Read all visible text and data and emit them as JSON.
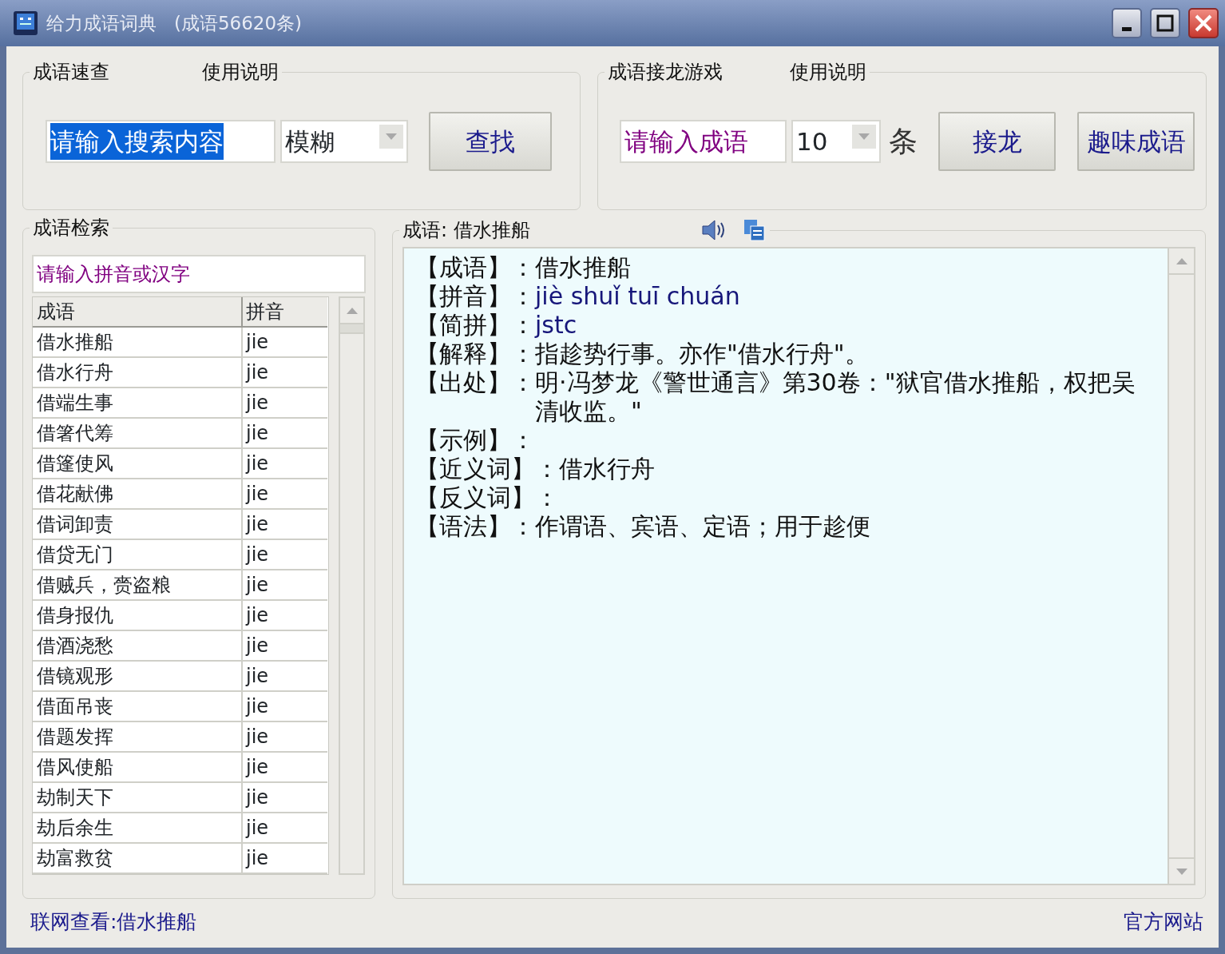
{
  "window": {
    "title": "给力成语词典   (成语56620条)"
  },
  "quick_search": {
    "title": "成语速查",
    "help_link": "使用说明",
    "input": {
      "value": "请输入搜索内容",
      "selected": true
    },
    "mode": {
      "value": "模糊"
    },
    "button": "查找"
  },
  "solitaire": {
    "title": "成语接龙游戏",
    "help_link": "使用说明",
    "input": {
      "placeholder": "请输入成语"
    },
    "count": {
      "value": "10"
    },
    "unit": "条",
    "buttons": [
      "接龙",
      "趣味成语"
    ]
  },
  "index": {
    "title": "成语检索",
    "filter": {
      "placeholder": "请输入拼音或汉字"
    },
    "table": {
      "columns": [
        "成语",
        "拼音"
      ],
      "rows": [
        [
          "借水推船",
          "jie"
        ],
        [
          "借水行舟",
          "jie"
        ],
        [
          "借端生事",
          "jie"
        ],
        [
          "借箸代筹",
          "jie"
        ],
        [
          "借篷使风",
          "jie"
        ],
        [
          "借花献佛",
          "jie"
        ],
        [
          "借词卸责",
          "jie"
        ],
        [
          "借贷无门",
          "jie"
        ],
        [
          "借贼兵，赍盗粮",
          "jie"
        ],
        [
          "借身报仇",
          "jie"
        ],
        [
          "借酒浇愁",
          "jie"
        ],
        [
          "借镜观形",
          "jie"
        ],
        [
          "借面吊丧",
          "jie"
        ],
        [
          "借题发挥",
          "jie"
        ],
        [
          "借风使船",
          "jie"
        ],
        [
          "劫制天下",
          "jie"
        ],
        [
          "劫后余生",
          "jie"
        ],
        [
          "劫富救贫",
          "jie"
        ]
      ]
    }
  },
  "detail": {
    "title": "成语: 借水推船",
    "lines": [
      {
        "kind": "text",
        "label": "【成语】：",
        "value": "借水推船"
      },
      {
        "kind": "pinyin",
        "label": "【拼音】：",
        "value": "jiè  shuǐ  tuī  chuán"
      },
      {
        "kind": "pinyin",
        "label": "【简拼】：",
        "value": "jstc"
      },
      {
        "kind": "text",
        "label": "【解释】：",
        "value": "指趁势行事。亦作\"借水行舟\"。"
      },
      {
        "kind": "text",
        "label": "【出处】：",
        "value": "明·冯梦龙《警世通言》第30卷：\"狱官借水推船，权把吴清收监。\""
      },
      {
        "kind": "text",
        "label": "【示例】："
      },
      {
        "kind": "text",
        "label": "【近义词】：",
        "value": "借水行舟"
      },
      {
        "kind": "text",
        "label": "【反义词】："
      },
      {
        "kind": "text",
        "label": "【语法】：",
        "value": "作谓语、宾语、定语；用于趁便"
      }
    ]
  },
  "footer": {
    "lookup_link": "联网查看:借水推船",
    "site_link": "官方网站"
  }
}
